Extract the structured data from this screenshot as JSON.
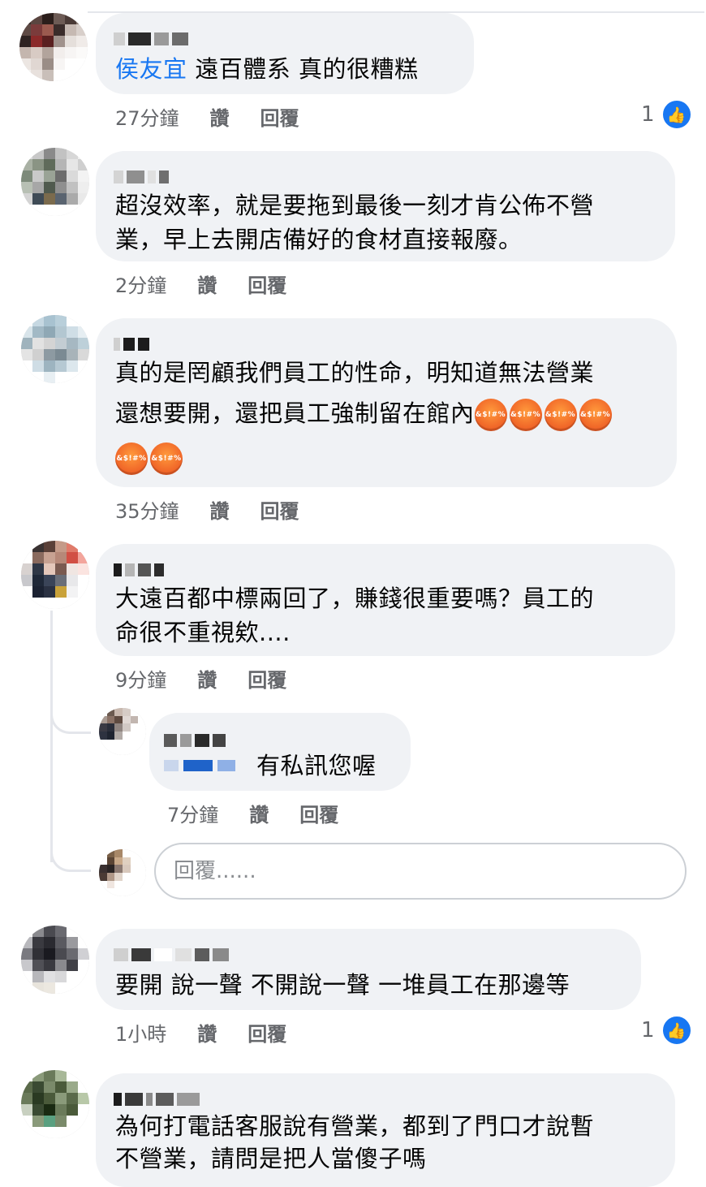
{
  "comments": [
    {
      "tag": "侯友宜",
      "text": "遠百體系 真的很糟糕",
      "time": "27分鐘",
      "like_label": "讚",
      "reply_label": "回覆",
      "like_count": "1"
    },
    {
      "line1": "超沒效率，就是要拖到最後一刻才肯公佈不營",
      "line2": "業，早上去開店備好的食材直接報廢。",
      "time": "2分鐘",
      "like_label": "讚",
      "reply_label": "回覆"
    },
    {
      "line1": "真的是罔顧我們員工的性命，明知道無法營業",
      "line2": "還想要開，還把員工強制留在館內",
      "emoji_label": "&$!#%",
      "time": "35分鐘",
      "like_label": "讚",
      "reply_label": "回覆"
    },
    {
      "line1": "大遠百都中標兩回了，賺錢很重要嗎？員工的",
      "line2": "命很不重視欸....",
      "time": "9分鐘",
      "like_label": "讚",
      "reply_label": "回覆",
      "reply": {
        "text": "有私訊您喔",
        "time": "7分鐘",
        "like_label": "讚",
        "reply_label": "回覆"
      }
    },
    {
      "text": "要開 說一聲 不開說一聲 一堆員工在那邊等",
      "time": "1小時",
      "like_label": "讚",
      "reply_label": "回覆",
      "like_count": "1"
    },
    {
      "line1": "為何打電話客服說有營業，都到了門口才說暫",
      "line2": "不營業，請問是把人當傻子嗎"
    }
  ],
  "reply_input": {
    "placeholder": "回覆......"
  },
  "icons": {
    "like": "like-thumb-icon",
    "emoji": "angry-cursing-face-icon"
  },
  "colors": {
    "tag": "#1877f2",
    "bubble": "#f0f2f5",
    "meta": "#65676b",
    "like_badge": "#1877f2"
  }
}
